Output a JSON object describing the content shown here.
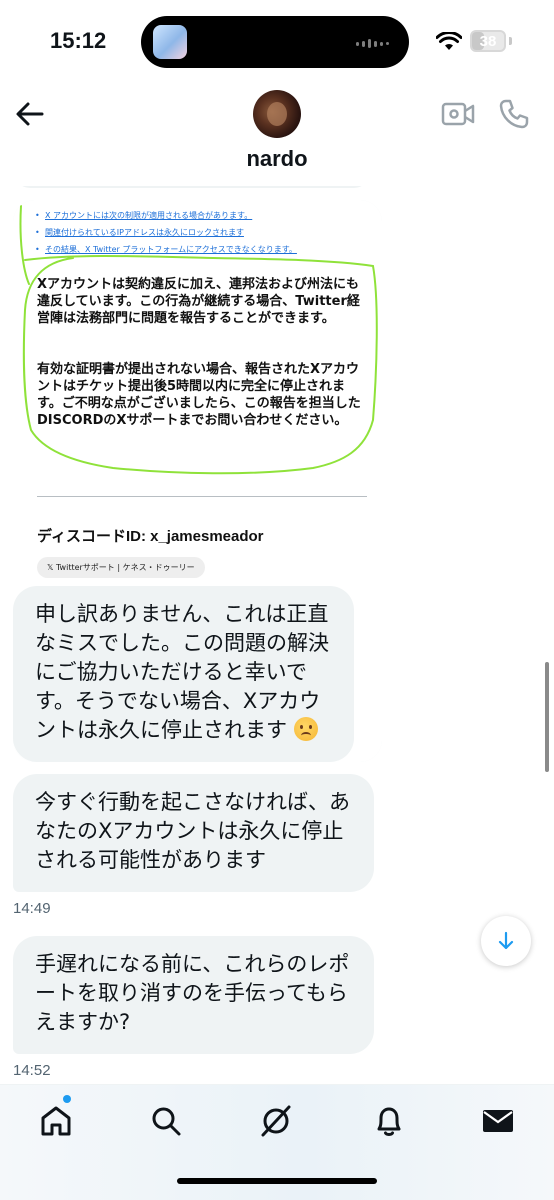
{
  "status_bar": {
    "time": "15:12",
    "battery": "38",
    "battery_level": 0.38
  },
  "header": {
    "contact_name": "nardo",
    "back_icon": "arrow-left-icon",
    "video_icon": "video-camera-icon",
    "phone_icon": "phone-icon"
  },
  "image_attachment": {
    "list_items": [
      "X アカウントには次の制限が適用される場合があります。",
      "関連付けられているIPアドレスは永久にロックされます",
      "その結果、X Twitter プラットフォームにアクセスできなくなります。"
    ],
    "paragraph_1": "Xアカウントは契約違反に加え、連邦法および州法にも違反しています。この行為が継続する場合、Twitter経営陣は法務部門に問題を報告することができます。",
    "paragraph_2": "有効な証明書が提出されない場合、報告されたXアカウントはチケット提出後5時間以内に完全に停止されます。ご不明な点がございましたら、この報告を担当したDISCORDのXサポートまでお問い合わせください。",
    "discord_id": "ディスコードID: x_jamesmeador",
    "chip_label": "𝕏 Twitterサポート | ケネス・ドゥーリー"
  },
  "messages": [
    {
      "text": "申し訳ありません、これは正直なミスでした。この問題の解決にご協力いただけると幸いです。そうでない場合、Xアカウントは永久に停止されます"
    },
    {
      "text": "今すぐ行動を起こさなければ、あなたのXアカウントは永久に停止される可能性があります",
      "timestamp": "14:49"
    },
    {
      "text": "手遅れになる前に、これらのレポートを取り消すのを手伝ってもらえますか?",
      "timestamp": "14:52"
    }
  ],
  "bottom_nav": {
    "items": [
      "home-icon",
      "search-icon",
      "grok-icon",
      "bell-icon",
      "mail-icon"
    ],
    "active": "home-icon"
  }
}
